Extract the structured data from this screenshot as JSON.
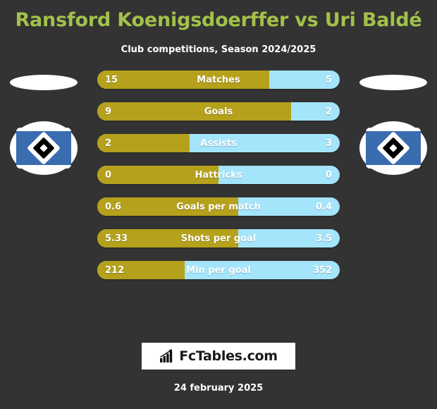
{
  "header": {
    "title": "Ransford Koenigsdoerffer vs Uri Baldé",
    "subtitle": "Club competitions, Season 2024/2025"
  },
  "colors": {
    "background": "#333333",
    "title": "#a2c14a",
    "home_bar": "#b5a11b",
    "away_bar": "#a5e5fb",
    "crest_blue": "#3a6cb0",
    "text": "#ffffff"
  },
  "crests": {
    "left": {
      "name": "hamburger-sv-crest"
    },
    "right": {
      "name": "hamburger-sv-crest"
    }
  },
  "chart_data": {
    "type": "bar",
    "title": "Ransford Koenigsdoerffer vs Uri Baldé",
    "subtitle": "Club competitions, Season 2024/2025",
    "orientation": "horizontal-diverging",
    "series": [
      {
        "name": "Ransford Koenigsdoerffer",
        "color": "#b5a11b"
      },
      {
        "name": "Uri Baldé",
        "color": "#a5e5fb"
      }
    ],
    "categories": [
      "Matches",
      "Goals",
      "Assists",
      "Hattricks",
      "Goals per match",
      "Shots per goal",
      "Min per goal"
    ],
    "rows": [
      {
        "label": "Matches",
        "home": "15",
        "away": "5",
        "home_pct": 71
      },
      {
        "label": "Goals",
        "home": "9",
        "away": "2",
        "home_pct": 80
      },
      {
        "label": "Assists",
        "home": "2",
        "away": "3",
        "home_pct": 38
      },
      {
        "label": "Hattricks",
        "home": "0",
        "away": "0",
        "home_pct": 50
      },
      {
        "label": "Goals per match",
        "home": "0.6",
        "away": "0.4",
        "home_pct": 58
      },
      {
        "label": "Shots per goal",
        "home": "5.33",
        "away": "3.5",
        "home_pct": 58
      },
      {
        "label": "Min per goal",
        "home": "212",
        "away": "352",
        "home_pct": 36
      }
    ]
  },
  "footer": {
    "brand": "FcTables.com",
    "brand_icon": "bar-chart-growth-icon",
    "date": "24 february 2025"
  }
}
